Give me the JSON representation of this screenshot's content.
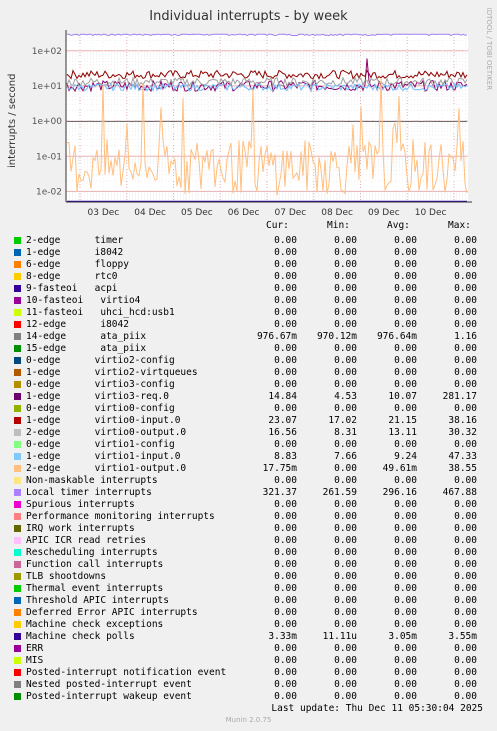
{
  "title": "Individual interrupts - by week",
  "side_label": "RRDTOOL / TOBI OETIKER",
  "ylabel": "interrupts / second",
  "columns": {
    "cur": "Cur:",
    "min": "Min:",
    "avg": "Avg:",
    "max": "Max:"
  },
  "last_update": "Last update: Thu Dec 11 05:30:04 2025",
  "footer": "Munin 2.0.75",
  "chart_data": {
    "type": "line",
    "title": "Individual interrupts - by week",
    "ylabel": "interrupts / second",
    "yscale": "log",
    "ylim": [
      0.005,
      300
    ],
    "yticks": [
      "1e-02",
      "1e-01",
      "1e+00",
      "1e+01",
      "1e+02"
    ],
    "x": [
      "03 Dec",
      "04 Dec",
      "05 Dec",
      "06 Dec",
      "07 Dec",
      "08 Dec",
      "09 Dec",
      "10 Dec"
    ],
    "series": [
      {
        "name": "Local timer interrupts",
        "color": "#9f7fef",
        "approx_level": 296.16
      },
      {
        "name": "virtio0-input.0",
        "color": "#8f0000",
        "approx_level": 21.15
      },
      {
        "name": "virtio3-req.0",
        "color": "#8f0069",
        "approx_level": 10.07
      },
      {
        "name": "virtio0-output.0",
        "color": "#a0a0a0",
        "approx_level": 13.11
      },
      {
        "name": "virtio1-input.0",
        "color": "#6fbfff",
        "approx_level": 9.24
      },
      {
        "name": "14-edge ata_piix",
        "color": "#6f6f6f",
        "approx_level": 0.976
      },
      {
        "name": "virtio1-output.0",
        "color": "#ffbf7f",
        "approx_level": 0.0496
      },
      {
        "name": "Machine check polls",
        "color": "#2f00af",
        "approx_level": 0.00305
      }
    ]
  },
  "rows": [
    {
      "name": "2-edge      timer",
      "color": "#00cc00",
      "cur": "0.00",
      "min": "0.00",
      "avg": "0.00",
      "max": "0.00"
    },
    {
      "name": "1-edge      i8042",
      "color": "#0066b3",
      "cur": "0.00",
      "min": "0.00",
      "avg": "0.00",
      "max": "0.00"
    },
    {
      "name": "6-edge      floppy",
      "color": "#ff8000",
      "cur": "0.00",
      "min": "0.00",
      "avg": "0.00",
      "max": "0.00"
    },
    {
      "name": "8-edge      rtc0",
      "color": "#ffcc00",
      "cur": "0.00",
      "min": "0.00",
      "avg": "0.00",
      "max": "0.00"
    },
    {
      "name": "9-fasteoi   acpi",
      "color": "#330099",
      "cur": "0.00",
      "min": "0.00",
      "avg": "0.00",
      "max": "0.00"
    },
    {
      "name": "10-fasteoi   virtio4",
      "color": "#990099",
      "cur": "0.00",
      "min": "0.00",
      "avg": "0.00",
      "max": "0.00"
    },
    {
      "name": "11-fasteoi   uhci_hcd:usb1",
      "color": "#ccff00",
      "cur": "0.00",
      "min": "0.00",
      "avg": "0.00",
      "max": "0.00"
    },
    {
      "name": "12-edge      i8042",
      "color": "#ff0000",
      "cur": "0.00",
      "min": "0.00",
      "avg": "0.00",
      "max": "0.00"
    },
    {
      "name": "14-edge      ata_piix",
      "color": "#808080",
      "cur": "976.67m",
      "min": "970.12m",
      "avg": "976.64m",
      "max": "1.16"
    },
    {
      "name": "15-edge      ata_piix",
      "color": "#008f00",
      "cur": "0.00",
      "min": "0.00",
      "avg": "0.00",
      "max": "0.00"
    },
    {
      "name": "0-edge      virtio2-config",
      "color": "#00487d",
      "cur": "0.00",
      "min": "0.00",
      "avg": "0.00",
      "max": "0.00"
    },
    {
      "name": "1-edge      virtio2-virtqueues",
      "color": "#b35a00",
      "cur": "0.00",
      "min": "0.00",
      "avg": "0.00",
      "max": "0.00"
    },
    {
      "name": "0-edge      virtio3-config",
      "color": "#b38f00",
      "cur": "0.00",
      "min": "0.00",
      "avg": "0.00",
      "max": "0.00"
    },
    {
      "name": "1-edge      virtio3-req.0",
      "color": "#6b006b",
      "cur": "14.84",
      "min": "4.53",
      "avg": "10.07",
      "max": "281.17"
    },
    {
      "name": "0-edge      virtio0-config",
      "color": "#8fb300",
      "cur": "0.00",
      "min": "0.00",
      "avg": "0.00",
      "max": "0.00"
    },
    {
      "name": "1-edge      virtio0-input.0",
      "color": "#b30000",
      "cur": "23.07",
      "min": "17.02",
      "avg": "21.15",
      "max": "38.16"
    },
    {
      "name": "2-edge      virtio0-output.0",
      "color": "#bebebe",
      "cur": "16.56",
      "min": "8.31",
      "avg": "13.11",
      "max": "30.32"
    },
    {
      "name": "0-edge      virtio1-config",
      "color": "#80ff80",
      "cur": "0.00",
      "min": "0.00",
      "avg": "0.00",
      "max": "0.00"
    },
    {
      "name": "1-edge      virtio1-input.0",
      "color": "#80c9ff",
      "cur": "8.83",
      "min": "7.66",
      "avg": "9.24",
      "max": "47.33"
    },
    {
      "name": "2-edge      virtio1-output.0",
      "color": "#ffc080",
      "cur": "17.75m",
      "min": "0.00",
      "avg": "49.61m",
      "max": "38.55"
    },
    {
      "name": "Non-maskable interrupts",
      "color": "#ffe680",
      "cur": "0.00",
      "min": "0.00",
      "avg": "0.00",
      "max": "0.00"
    },
    {
      "name": "Local timer interrupts",
      "color": "#aa80ff",
      "cur": "321.37",
      "min": "261.59",
      "avg": "296.16",
      "max": "467.88"
    },
    {
      "name": "Spurious interrupts",
      "color": "#ee00cc",
      "cur": "0.00",
      "min": "0.00",
      "avg": "0.00",
      "max": "0.00"
    },
    {
      "name": "Performance monitoring interrupts",
      "color": "#ff8080",
      "cur": "0.00",
      "min": "0.00",
      "avg": "0.00",
      "max": "0.00"
    },
    {
      "name": "IRQ work interrupts",
      "color": "#666600",
      "cur": "0.00",
      "min": "0.00",
      "avg": "0.00",
      "max": "0.00"
    },
    {
      "name": "APIC ICR read retries",
      "color": "#ffbfff",
      "cur": "0.00",
      "min": "0.00",
      "avg": "0.00",
      "max": "0.00"
    },
    {
      "name": "Rescheduling interrupts",
      "color": "#00ffcc",
      "cur": "0.00",
      "min": "0.00",
      "avg": "0.00",
      "max": "0.00"
    },
    {
      "name": "Function call interrupts",
      "color": "#cc6699",
      "cur": "0.00",
      "min": "0.00",
      "avg": "0.00",
      "max": "0.00"
    },
    {
      "name": "TLB shootdowns",
      "color": "#999900",
      "cur": "0.00",
      "min": "0.00",
      "avg": "0.00",
      "max": "0.00"
    },
    {
      "name": "Thermal event interrupts",
      "color": "#00cc00",
      "cur": "0.00",
      "min": "0.00",
      "avg": "0.00",
      "max": "0.00"
    },
    {
      "name": "Threshold APIC interrupts",
      "color": "#0066b3",
      "cur": "0.00",
      "min": "0.00",
      "avg": "0.00",
      "max": "0.00"
    },
    {
      "name": "Deferred Error APIC interrupts",
      "color": "#ff8000",
      "cur": "0.00",
      "min": "0.00",
      "avg": "0.00",
      "max": "0.00"
    },
    {
      "name": "Machine check exceptions",
      "color": "#ffcc00",
      "cur": "0.00",
      "min": "0.00",
      "avg": "0.00",
      "max": "0.00"
    },
    {
      "name": "Machine check polls",
      "color": "#330099",
      "cur": "3.33m",
      "min": "11.11u",
      "avg": "3.05m",
      "max": "3.55m"
    },
    {
      "name": "ERR",
      "color": "#990099",
      "cur": "0.00",
      "min": "0.00",
      "avg": "0.00",
      "max": "0.00"
    },
    {
      "name": "MIS",
      "color": "#ccff00",
      "cur": "0.00",
      "min": "0.00",
      "avg": "0.00",
      "max": "0.00"
    },
    {
      "name": "Posted-interrupt notification event",
      "color": "#ff0000",
      "cur": "0.00",
      "min": "0.00",
      "avg": "0.00",
      "max": "0.00"
    },
    {
      "name": "Nested posted-interrupt event",
      "color": "#808080",
      "cur": "0.00",
      "min": "0.00",
      "avg": "0.00",
      "max": "0.00"
    },
    {
      "name": "Posted-interrupt wakeup event",
      "color": "#008f00",
      "cur": "0.00",
      "min": "0.00",
      "avg": "0.00",
      "max": "0.00"
    }
  ]
}
